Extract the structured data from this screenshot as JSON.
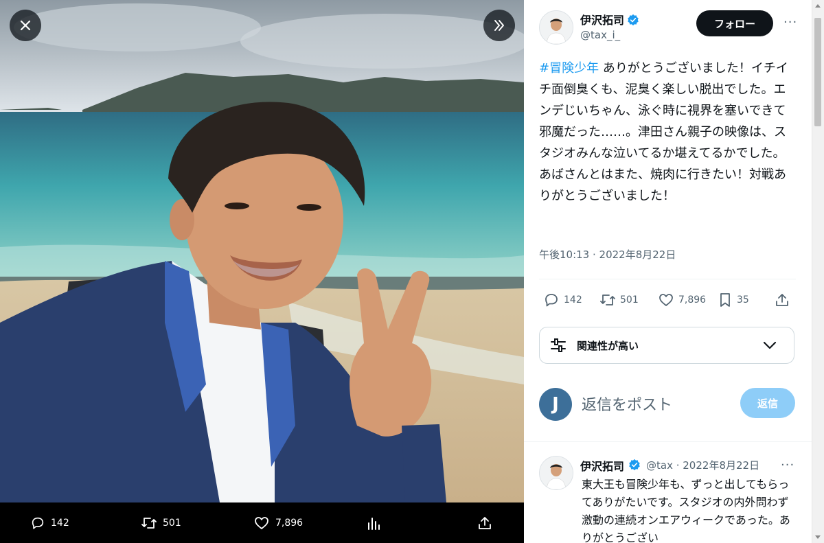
{
  "media_bar": {
    "replies": "142",
    "retweets": "501",
    "likes": "7,896"
  },
  "tweet": {
    "author_name": "伊沢拓司",
    "author_handle": "@tax_i_",
    "follow_label": "フォロー",
    "hashtag": "#冒険少年",
    "text": " ありがとうございました！イチイチ面倒臭くも、泥臭く楽しい脱出でした。エンデじいちゃん、泳ぐ時に視界を塞いできて邪魔だった……。津田さん親子の映像は、スタジオみんな泣いてるか堪えてるかでした。あばさんとはまた、焼肉に行きたい！対戦ありがとうございました！",
    "timestamp": "午後10:13 · 2022年8月22日",
    "replies": "142",
    "retweets": "501",
    "likes": "7,896",
    "bookmarks": "35"
  },
  "sort": {
    "label": "関連性が高い"
  },
  "compose": {
    "avatar_letter": "J",
    "placeholder": "返信をポスト",
    "button_label": "返信"
  },
  "reply": {
    "author_name": "伊沢拓司",
    "author_handle": "@tax",
    "date": "2022年8月22日",
    "text": "東大王も冒険少年も、ずっと出してもらってありがたいです。スタジオの内外問わず激動の連続オンエアウィークであった。ありがとうござい"
  },
  "colors": {
    "accent": "#1d9bf0",
    "verified": "#1d9bf0",
    "reply_button_disabled": "#8ecdf8",
    "follow_button": "#0f1419"
  },
  "icons": [
    "close-icon",
    "next-icon",
    "reply-icon",
    "retweet-icon",
    "like-icon",
    "analytics-icon",
    "share-icon",
    "bookmark-icon",
    "sort-icon",
    "chevron-down-icon",
    "more-icon",
    "verified-icon"
  ]
}
